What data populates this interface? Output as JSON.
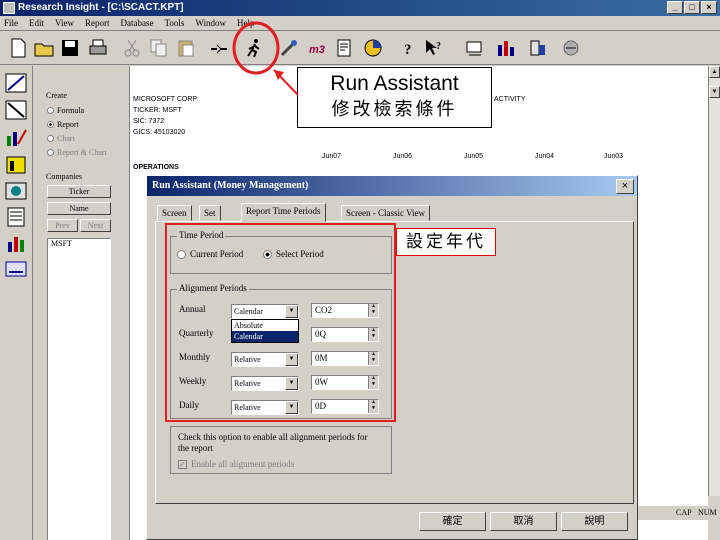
{
  "window": {
    "title": "Research Insight - [C:\\SCACT.KPT]"
  },
  "menu": [
    "File",
    "Edit",
    "View",
    "Report",
    "Database",
    "Tools",
    "Window",
    "Help"
  ],
  "callout": {
    "line1": "Run Assistant",
    "line2": "修改檢索條件"
  },
  "annotation": {
    "label": "設定年代"
  },
  "side": {
    "create_label": "Create",
    "radios": [
      {
        "label": "Formula",
        "checked": false
      },
      {
        "label": "Report",
        "checked": true
      },
      {
        "label": "Chart",
        "checked": false
      },
      {
        "label": "Report & Chart",
        "checked": false
      }
    ],
    "companies_label": "Companies",
    "ticker_btn": "Ticker",
    "name_btn": "Name",
    "prev_btn": "Prev",
    "next_btn": "Next",
    "list": [
      "MSFT"
    ]
  },
  "doc": {
    "company": "MICROSOFT CORP",
    "ticker": "TICKER:  MSFT",
    "sic": "SIC:  7372",
    "gics": "GICS:  45103020",
    "activity": "ACTIVITY",
    "years": [
      "Jun07",
      "Jun06",
      "Jun05",
      "Jun04",
      "Jun03"
    ],
    "operations": "OPERATIONS"
  },
  "dialog": {
    "title": "Run Assistant   (Money Management)",
    "tabs": [
      "Screen",
      "Set",
      "Report Time Periods",
      "Screen - Classic View"
    ],
    "time_period": {
      "group": "Time Period",
      "current": "Current Period",
      "select": "Select Period"
    },
    "alignment": {
      "group": "Alignment Periods",
      "rows": [
        {
          "label": "Annual",
          "mode": "Calendar",
          "value": "CO2"
        },
        {
          "label": "Quarterly",
          "mode": "Calendar",
          "value": "0Q"
        },
        {
          "label": "Monthly",
          "mode": "Relative",
          "value": "0M"
        },
        {
          "label": "Weekly",
          "mode": "Relative",
          "value": "0W"
        },
        {
          "label": "Daily",
          "mode": "Relative",
          "value": "0D"
        }
      ],
      "dropdown": [
        "Absolute",
        "Calendar"
      ]
    },
    "note": "Check this option to enable all alignment periods for the report",
    "enable_all": "Enable all alignment periods",
    "ok": "確定",
    "cancel": "取消",
    "help": "說明"
  },
  "status": {
    "cap": "CAP",
    "num": "NUM"
  }
}
